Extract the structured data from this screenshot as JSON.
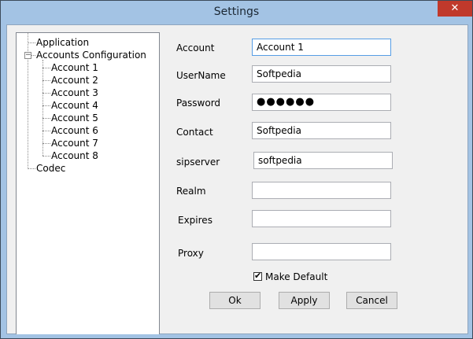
{
  "window": {
    "title": "Settings",
    "close_glyph": "✕"
  },
  "tree": {
    "root_items": [
      {
        "label": "Application"
      },
      {
        "label": "Accounts Configuration",
        "expanded": true,
        "expander_glyph": "−"
      },
      {
        "label": "Codec"
      }
    ],
    "accounts": [
      "Account 1",
      "Account 2",
      "Account 3",
      "Account 4",
      "Account 5",
      "Account 6",
      "Account 7",
      "Account 8"
    ]
  },
  "form": {
    "account_label": "Account",
    "account_value": "Account 1",
    "username_label": "UserName",
    "username_value": "Softpedia",
    "password_label": "Password",
    "password_value": "●●●●●●",
    "contact_label": "Contact",
    "contact_value": "Softpedia",
    "sipserver_label": "sipserver",
    "sipserver_value": "softpedia",
    "realm_label": "Realm",
    "realm_value": "",
    "expires_label": "Expires",
    "expires_value": "",
    "proxy_label": "Proxy",
    "proxy_value": "",
    "make_default_label": "Make Default",
    "make_default_checked": true,
    "check_glyph": "✔"
  },
  "buttons": {
    "ok": "Ok",
    "apply": "Apply",
    "cancel": "Cancel"
  },
  "colors": {
    "titlebar": "#a3c3e4",
    "close": "#c0392b",
    "focus_border": "#569de5"
  }
}
